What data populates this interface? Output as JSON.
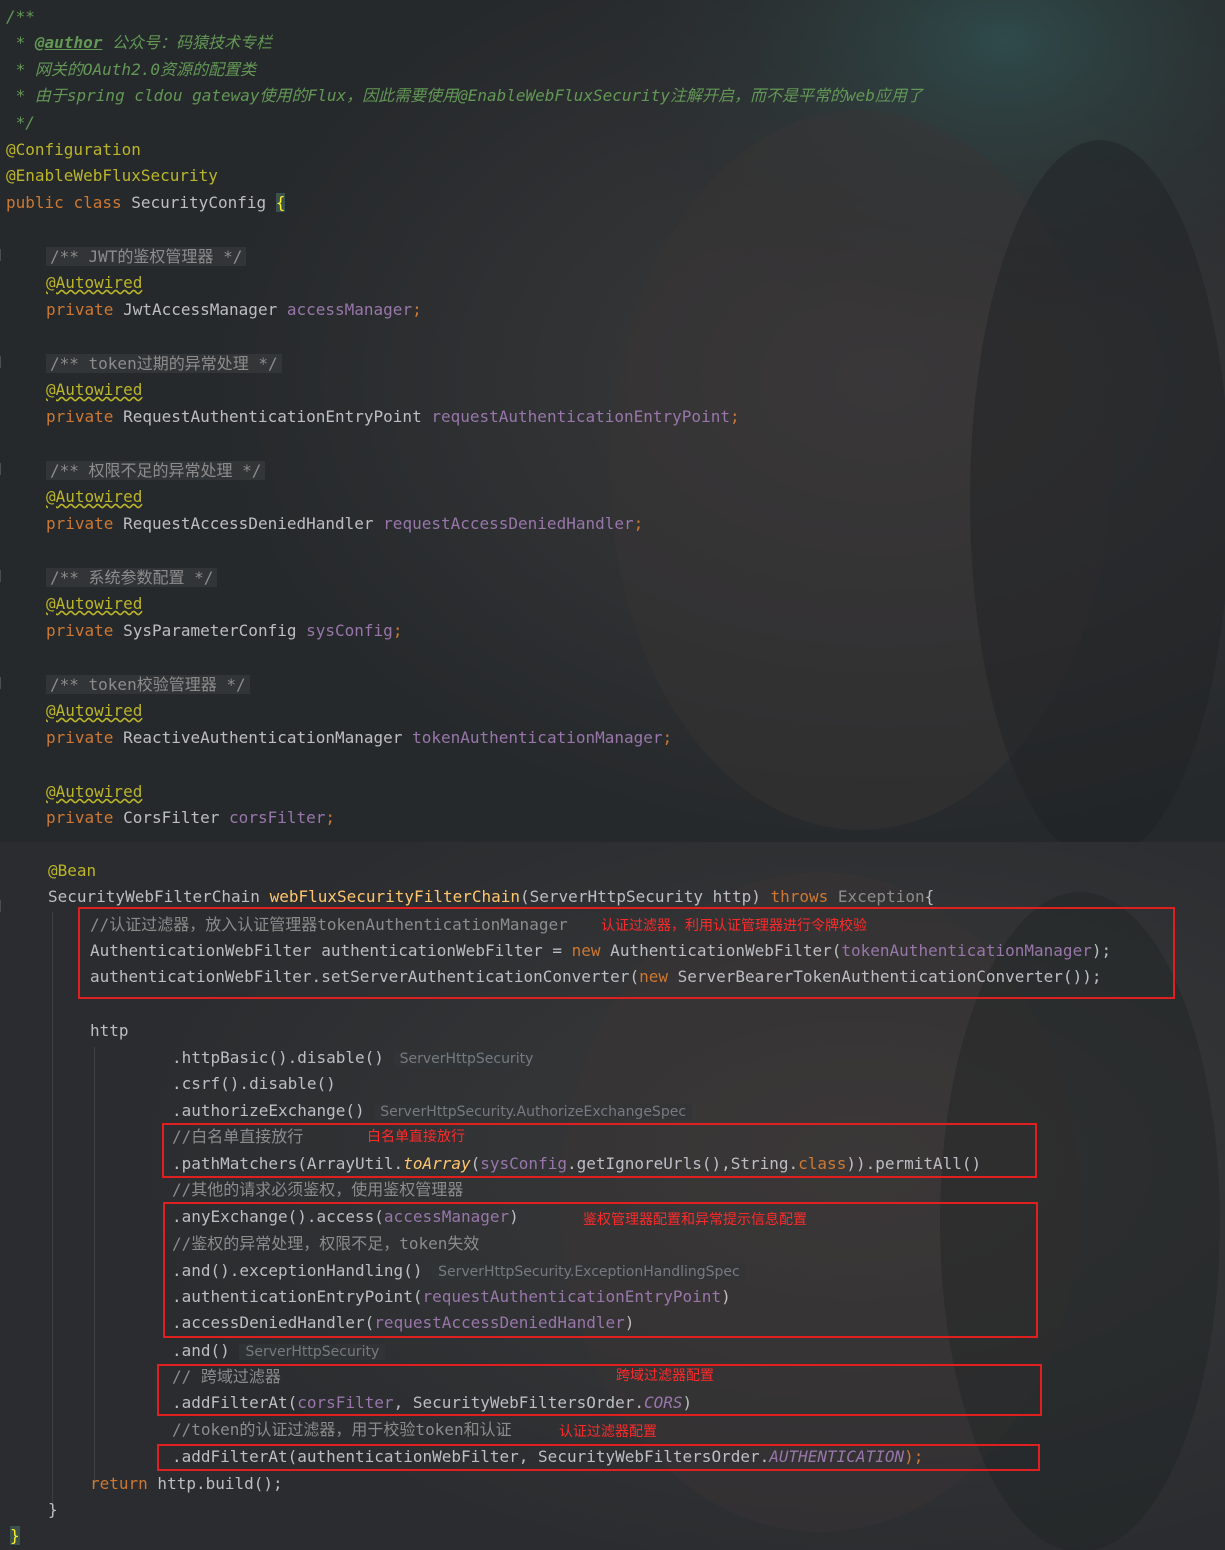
{
  "top": {
    "doc_lines": [
      "/**",
      " * ",
      "@author",
      " 公众号：码猿技术专栏",
      " * 网关的OAuth2.0资源的配置类",
      " * 由于spring cldou gateway使用的Flux，因此需要使用@EnableWebFluxSecurity注解开启，而不是平常的web应用了",
      " */"
    ],
    "annotations": [
      "@Configuration",
      "@EnableWebFluxSecurity"
    ],
    "class_decl": {
      "kw_public": "public",
      "kw_class": "class",
      "name": "SecurityConfig",
      "brace": "{"
    },
    "fields": [
      {
        "comment": "/** JWT的鉴权管理器 */",
        "annotation": "@Autowired",
        "kw": "private",
        "type": "JwtAccessManager",
        "name": "accessManager",
        "semi": ";"
      },
      {
        "comment": "/** token过期的异常处理 */",
        "annotation": "@Autowired",
        "kw": "private",
        "type": "RequestAuthenticationEntryPoint",
        "name": "requestAuthenticationEntryPoint",
        "semi": ";"
      },
      {
        "comment": "/** 权限不足的异常处理 */",
        "annotation": "@Autowired",
        "kw": "private",
        "type": "RequestAccessDeniedHandler",
        "name": "requestAccessDeniedHandler",
        "semi": ";"
      },
      {
        "comment": "/** 系统参数配置 */",
        "annotation": "@Autowired",
        "kw": "private",
        "type": "SysParameterConfig",
        "name": "sysConfig",
        "semi": ";"
      },
      {
        "comment": "/** token校验管理器 */",
        "annotation": "@Autowired",
        "kw": "private",
        "type": "ReactiveAuthenticationManager",
        "name": "tokenAuthenticationManager",
        "semi": ";"
      },
      {
        "comment": "",
        "annotation": "@Autowired",
        "kw": "private",
        "type": "CorsFilter",
        "name": "corsFilter",
        "semi": ";"
      }
    ]
  },
  "bottom": {
    "bean": "@Bean",
    "method": {
      "ret": "SecurityWebFilterChain ",
      "name": "webFluxSecurityFilterChain",
      "params": "(ServerHttpSecurity http) ",
      "throws": "throws",
      "exc": " Exception",
      "open": "{"
    },
    "l_auth_comment": "//认证过滤器，放入认证管理器tokenAuthenticationManager",
    "l_auth_decl": {
      "a": "AuthenticationWebFilter authenticationWebFilter = ",
      "new": "new",
      "b": " AuthenticationWebFilter(",
      "arg": "tokenAuthenticationManager",
      "c": ");"
    },
    "l_auth_conv": {
      "a": "authenticationWebFilter.setServerAuthenticationConverter(",
      "new": "new",
      "b": " ServerBearerTokenAuthenticationConverter());"
    },
    "http": "http",
    "l_basic": ".httpBasic().disable()",
    "l_basic_hint": "ServerHttpSecurity",
    "l_csrf": ".csrf().disable()",
    "l_authx": ".authorizeExchange()",
    "l_authx_hint": "ServerHttpSecurity.AuthorizeExchangeSpec",
    "l_white_comment": "//白名单直接放行",
    "l_path": {
      "a": ".pathMatchers(ArrayUtil.",
      "fn": "toArray",
      "b": "(",
      "fld": "sysConfig",
      "c": ".getIgnoreUrls(),String.",
      "cls": "class",
      "d": ")).permitAll()"
    },
    "l_other_comment": "//其他的请求必须鉴权，使用鉴权管理器",
    "l_any": {
      "a": ".anyExchange().access(",
      "fld": "accessManager",
      "b": ")"
    },
    "l_exc_comment": "//鉴权的异常处理，权限不足，token失效",
    "l_exc": ".and().exceptionHandling()",
    "l_exc_hint": "ServerHttpSecurity.ExceptionHandlingSpec",
    "l_entry": {
      "a": ".authenticationEntryPoint(",
      "fld": "requestAuthenticationEntryPoint",
      "b": ")"
    },
    "l_denied": {
      "a": ".accessDeniedHandler(",
      "fld": "requestAccessDeniedHandler",
      "b": ")"
    },
    "l_and": ".and()",
    "l_and_hint": "ServerHttpSecurity",
    "l_cors_comment": "// 跨域过滤器",
    "l_cors": {
      "a": ".addFilterAt(",
      "fld": "corsFilter",
      "b": ", SecurityWebFiltersOrder.",
      "const": "CORS",
      "c": ")"
    },
    "l_token_comment": "//token的认证过滤器，用于校验token和认证",
    "l_addauth": {
      "a": ".addFilterAt(authenticationWebFilter, SecurityWebFiltersOrder.",
      "const": "AUTHENTICATION",
      "b": ");"
    },
    "l_return": {
      "kw": "return",
      "rest": " http.build();"
    },
    "close_method": "}",
    "close_class": "}"
  },
  "red_labels": {
    "auth_filter": "认证过滤器，利用认证管理器进行令牌校验",
    "whitelist": "白名单直接放行",
    "access": "鉴权管理器配置和异常提示信息配置",
    "cors": "跨域过滤器配置",
    "auth_config": "认证过滤器配置"
  },
  "colors": {
    "keyword": "#cc7832",
    "annotation": "#bbb529",
    "field": "#9876aa",
    "doc_comment": "#629755",
    "comment": "#8c8c8c",
    "method": "#ffc66d",
    "default_text": "#bcbec4",
    "red_box": "#e02020"
  }
}
